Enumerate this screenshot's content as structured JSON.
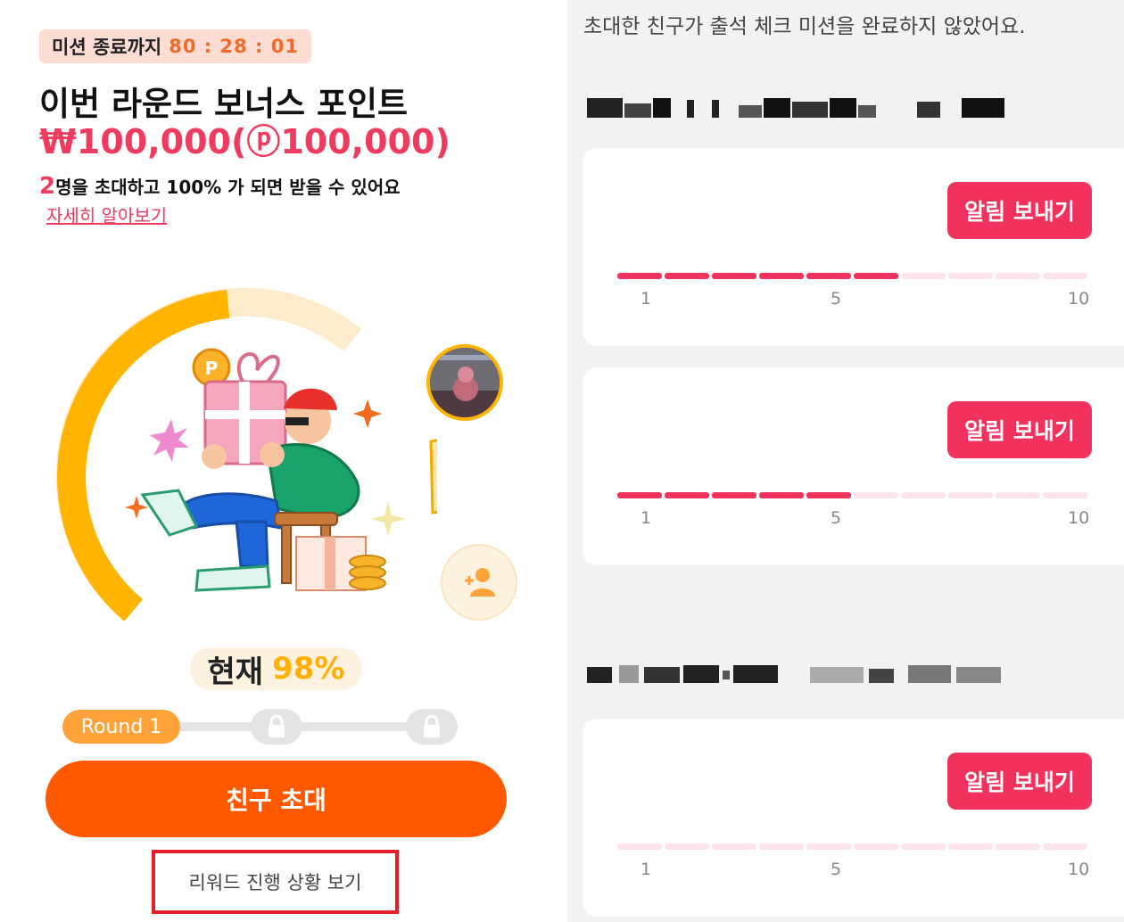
{
  "mission": {
    "timer_label": "미션 종료까지",
    "timer_value": "80 : 28 : 01",
    "title": "이번 라운드 보너스 포인트",
    "amount": "₩100,000(ⓟ100,000)",
    "invite_count": "2",
    "invite_text": "명을 초대하고 100% 가 되면 받을 수 있어요",
    "more_link": "자세히 알아보기",
    "progress_percent": 98,
    "current_label": "현재",
    "current_value": "98%",
    "round_label": "Round 1",
    "locked_rounds": 2,
    "invite_button": "친구 초대",
    "reward_link": "리워드 진행 상황 보기"
  },
  "friends": {
    "notice": "초대한 친구가 출석 체크 미션을 완료하지 않았어요.",
    "cards": [
      {
        "button": "알림 보내기",
        "progress": 6,
        "total": 10,
        "ticks": [
          "1",
          "5",
          "10"
        ]
      },
      {
        "button": "알림 보내기",
        "progress": 5,
        "total": 10,
        "ticks": [
          "1",
          "5",
          "10"
        ]
      },
      {
        "button": "알림 보내기",
        "progress": 0,
        "total": 10,
        "ticks": [
          "1",
          "5",
          "10"
        ]
      }
    ]
  },
  "colors": {
    "accent_orange": "#ff5900",
    "accent_yellow": "#ffb000",
    "accent_pink": "#f0325c",
    "track_pink": "#fde4ea"
  }
}
